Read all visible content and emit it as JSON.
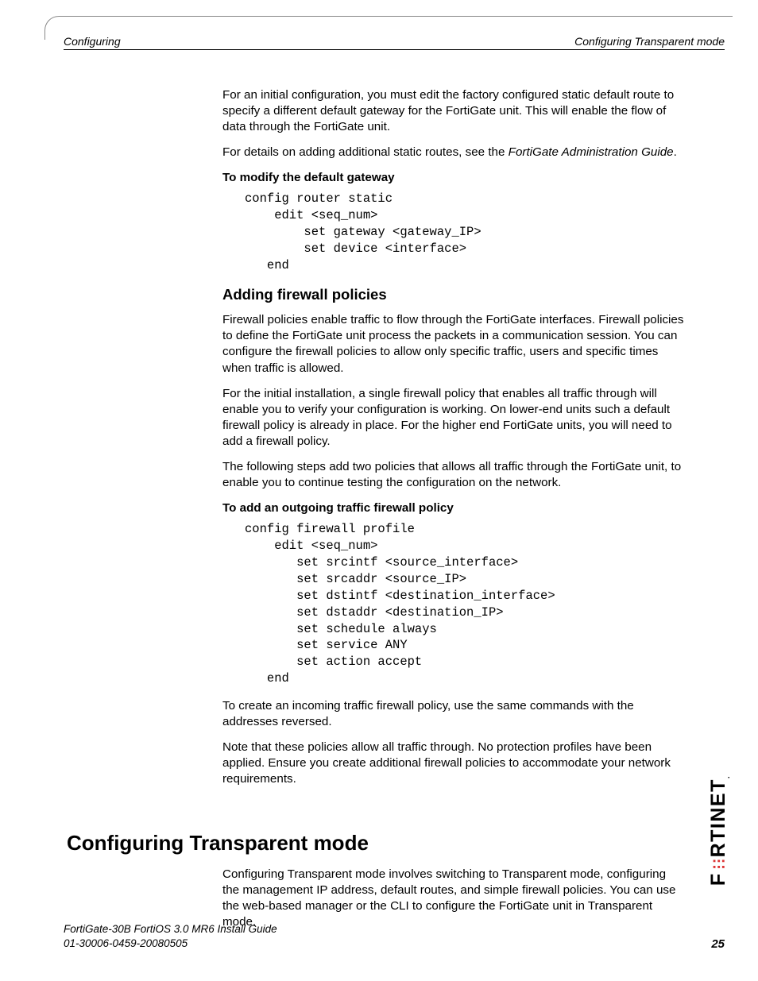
{
  "header": {
    "left": "Configuring",
    "right": "Configuring Transparent mode"
  },
  "body": {
    "p1": "For an initial configuration, you must edit the factory configured static default route to specify a different default gateway for the FortiGate unit. This will enable the flow of data through the FortiGate unit.",
    "p2a": "For details on adding additional static routes, see the ",
    "p2b": "FortiGate Administration Guide",
    "p2c": ".",
    "proc1_title": "To modify the default gateway",
    "code1": "config router static\n    edit <seq_num>\n        set gateway <gateway_IP>\n        set device <interface>\n   end",
    "sect_title": "Adding firewall policies",
    "p3": "Firewall policies enable traffic to flow through the FortiGate interfaces. Firewall policies to define the FortiGate unit process the packets in a communication session. You can configure the firewall policies to allow only specific traffic, users and specific times when traffic is allowed.",
    "p4": "For the initial installation, a single firewall policy that enables all traffic through will enable you to verify your configuration is working. On lower-end units such a default firewall policy is already in place. For the higher end FortiGate units, you will need to add a firewall policy.",
    "p5": "The following steps add two policies that allows all traffic through the FortiGate unit, to enable you to continue testing the configuration on the network.",
    "proc2_title": "To add an outgoing traffic firewall policy",
    "code2": "config firewall profile\n    edit <seq_num>\n       set srcintf <source_interface>\n       set srcaddr <source_IP>\n       set dstintf <destination_interface>\n       set dstaddr <destination_IP>\n       set schedule always\n       set service ANY\n       set action accept\n   end",
    "p6": "To create an incoming traffic firewall policy, use the same commands with the addresses reversed.",
    "p7": "Note that these policies allow all traffic through. No protection profiles have been applied. Ensure you create additional firewall policies to accommodate your network requirements."
  },
  "h1": {
    "title": "Configuring Transparent mode",
    "p1": "Configuring Transparent mode involves switching to Transparent mode, configuring the management IP address, default routes, and simple firewall policies. You can use the web-based manager or the CLI to configure the FortiGate unit in Transparent mode."
  },
  "footer": {
    "line1": "FortiGate-30B FortiOS 3.0 MR6 Install Guide",
    "line2": "01-30006-0459-20080505",
    "page": "25"
  },
  "logo": {
    "text_a": "F",
    "text_b": "RTINET",
    "suffix": "."
  }
}
